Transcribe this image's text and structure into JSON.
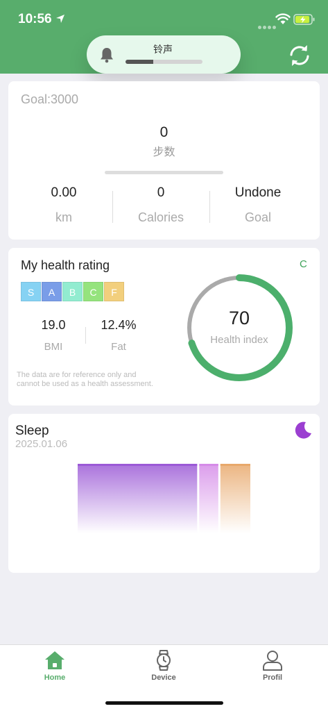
{
  "status_bar": {
    "time": "10:56"
  },
  "ringtone": {
    "label": "铃声",
    "volume_fraction": 0.36
  },
  "steps_card": {
    "goal_text": "Goal:3000",
    "steps_value": "0",
    "steps_unit": "步数",
    "stats": [
      {
        "value": "0.00",
        "label": "km"
      },
      {
        "value": "0",
        "label": "Calories"
      },
      {
        "value": "Undone",
        "label": "Goal"
      }
    ]
  },
  "health": {
    "title": "My health rating",
    "current_grade": "C",
    "grades": [
      {
        "letter": "S",
        "color": "#86d2f3"
      },
      {
        "letter": "A",
        "color": "#7a9de8"
      },
      {
        "letter": "B",
        "color": "#92ecd0"
      },
      {
        "letter": "C",
        "color": "#95e37d"
      },
      {
        "letter": "F",
        "color": "#f2cf7d"
      }
    ],
    "bmi_value": "19.0",
    "bmi_label": "BMI",
    "fat_value": "12.4%",
    "fat_label": "Fat",
    "disclaimer": "The data are for reference only and cannot be used as a health assessment.",
    "index_value": 70,
    "index_max": 100,
    "index_label": "Health index"
  },
  "sleep": {
    "title": "Sleep",
    "date": "2025.01.06",
    "segments": [
      {
        "stage": "deep",
        "duration": 0.69,
        "color": "#9b59d6"
      },
      {
        "stage": "light",
        "duration": 0.12,
        "color": "#d58be8"
      },
      {
        "stage": "awake",
        "duration": 0.17,
        "color": "#e8a86b"
      }
    ]
  },
  "colors": {
    "brand_green": "#58ad6c",
    "gauge_green": "#4caf6c",
    "gauge_gray": "#aaaaaa"
  },
  "tabs": [
    {
      "label": "Home",
      "icon": "home-icon",
      "active": true
    },
    {
      "label": "Device",
      "icon": "watch-icon",
      "active": false
    },
    {
      "label": "Profil",
      "icon": "person-icon",
      "active": false
    }
  ]
}
